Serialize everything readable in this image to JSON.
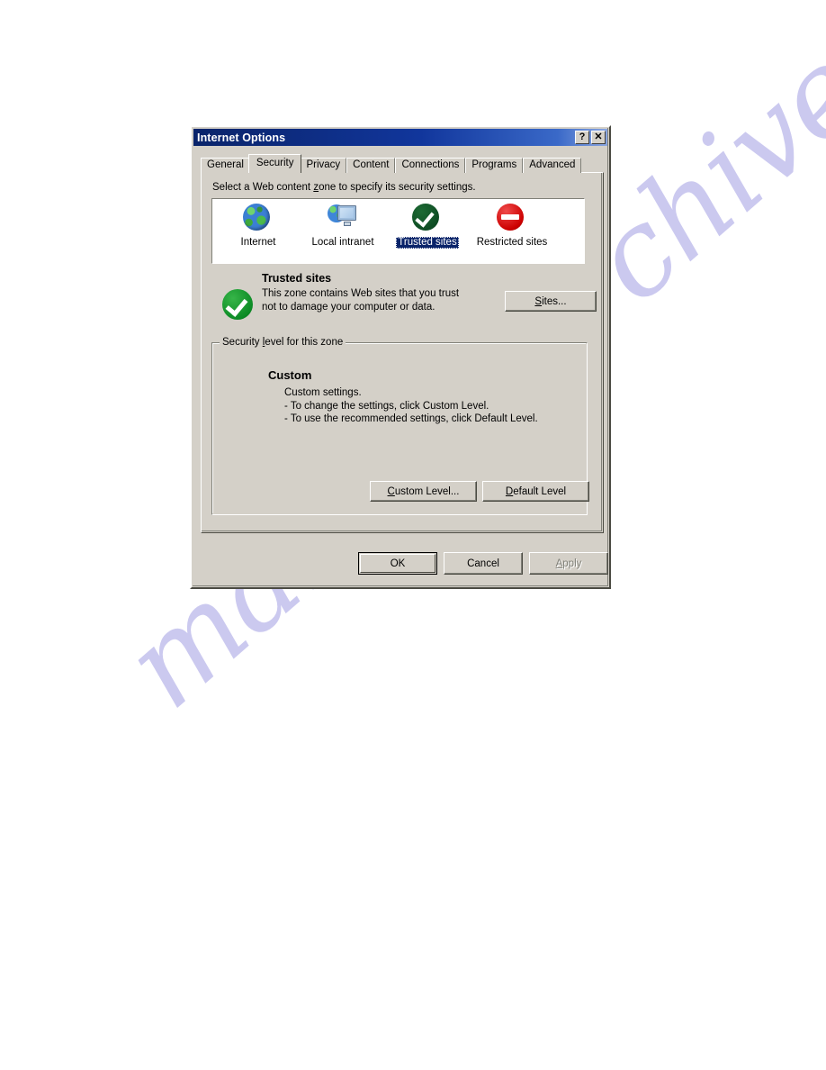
{
  "watermark": {
    "text": "manualsarchive.com",
    "color": "#c9c7ef"
  },
  "dialog": {
    "title": "Internet Options",
    "titlebar_buttons": [
      {
        "name": "help-button",
        "glyph": "?"
      },
      {
        "name": "close-button",
        "glyph": "✕"
      }
    ],
    "tabs": [
      {
        "label": "General",
        "accel": "G",
        "active": false
      },
      {
        "label": "Security",
        "accel": "S",
        "active": true
      },
      {
        "label": "Privacy",
        "accel": "P",
        "active": false
      },
      {
        "label": "Content",
        "accel": "C",
        "active": false
      },
      {
        "label": "Connections",
        "accel": "o",
        "active": false
      },
      {
        "label": "Programs",
        "accel": "r",
        "active": false
      },
      {
        "label": "Advanced",
        "accel": "d",
        "active": false
      }
    ],
    "security_tab": {
      "intro_before": "Select a Web content ",
      "intro_accel": "z",
      "intro_after": "one to specify its security settings.",
      "intro_full": "Select a Web content zone to specify its security settings.",
      "zones": [
        {
          "label": "Internet",
          "icon": "globe-icon",
          "selected": false
        },
        {
          "label": "Local intranet",
          "icon": "intranet-icon",
          "selected": false
        },
        {
          "label": "Trusted sites",
          "icon": "check-icon",
          "selected": true
        },
        {
          "label": "Restricted sites",
          "icon": "deny-icon",
          "selected": false
        }
      ],
      "zone_description": {
        "icon": "check-icon-large",
        "title": "Trusted sites",
        "body": "This zone contains Web sites that you trust not to damage your computer or data."
      },
      "sites_button": {
        "label": "Sites...",
        "accel": "S",
        "enabled": true
      },
      "group": {
        "legend_before": "Security ",
        "legend_accel": "l",
        "legend_after": "evel for this zone",
        "legend_full": "Security level for this zone",
        "level_name": "Custom",
        "level_lines": [
          "Custom settings.",
          "- To change the settings, click Custom Level.",
          "- To use the recommended settings, click Default Level."
        ],
        "custom_level_button": {
          "label": "Custom Level...",
          "accel": "C",
          "enabled": true
        },
        "default_level_button": {
          "label": "Default Level",
          "accel": "D",
          "enabled": true
        }
      }
    },
    "footer_buttons": [
      {
        "name": "ok-button",
        "label": "OK",
        "enabled": true,
        "default": true
      },
      {
        "name": "cancel-button",
        "label": "Cancel",
        "enabled": true,
        "default": false
      },
      {
        "name": "apply-button",
        "label": "Apply",
        "accel": "A",
        "enabled": false,
        "default": false
      }
    ]
  },
  "colors": {
    "dialog_face": "#d4d0c8",
    "titlebar_start": "#0a246a",
    "titlebar_end": "#8aa6e0",
    "selection_blue": "#0a246a",
    "trusted_green": "#0d8a25",
    "restricted_red": "#cc0000",
    "page_background": "#ffffff"
  }
}
